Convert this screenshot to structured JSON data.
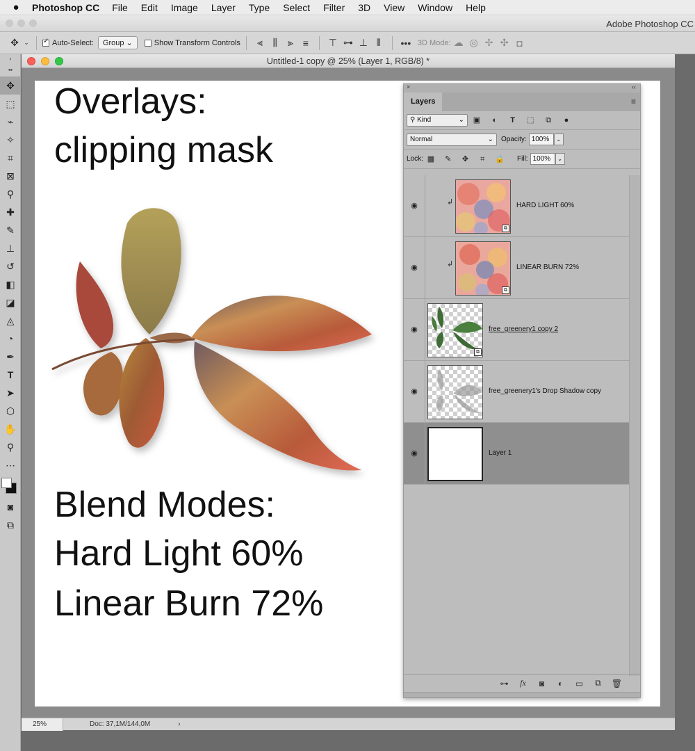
{
  "menubar": {
    "apple": "",
    "app_name": "Photoshop CC",
    "items": [
      "File",
      "Edit",
      "Image",
      "Layer",
      "Type",
      "Select",
      "Filter",
      "3D",
      "View",
      "Window",
      "Help"
    ]
  },
  "app_title": "Adobe Photoshop CC",
  "options": {
    "auto_select_label": "Auto-Select:",
    "auto_select_checked": true,
    "auto_select_value": "Group",
    "transform_label": "Show Transform Controls",
    "more": "•••",
    "mode_3d_label": "3D Mode:"
  },
  "document": {
    "title": "Untitled-1 copy @ 25% (Layer 1, RGB/8) *",
    "canvas_text": {
      "line1": "Overlays:",
      "line2": "clipping mask",
      "line3": "Blend Modes:",
      "line4": "Hard Light  60%",
      "line5": "Linear Burn 72%"
    },
    "status": {
      "zoom": "25%",
      "doc": "Doc: 37,1M/144,0M",
      "arrow": "›"
    }
  },
  "layers_panel": {
    "close": "×",
    "collapse": "‹‹",
    "tab": "Layers",
    "menu_icon": "≡",
    "filter_kind": "Kind",
    "blend_mode": "Normal",
    "opacity_label": "Opacity:",
    "opacity": "100%",
    "lock_label": "Lock:",
    "fill_label": "Fill:",
    "fill": "100%",
    "layers": [
      {
        "name": "HARD LIGHT 60%",
        "clipped": true,
        "selected": false,
        "linked": false
      },
      {
        "name": "LINEAR BURN 72%",
        "clipped": true,
        "selected": false,
        "linked": false
      },
      {
        "name": "free_greenery1 copy 2",
        "clipped": false,
        "selected": false,
        "linked": true
      },
      {
        "name": "free_greenery1's Drop Shadow copy",
        "clipped": false,
        "selected": false,
        "linked": false
      },
      {
        "name": "Layer 1",
        "clipped": false,
        "selected": true,
        "linked": false
      }
    ]
  }
}
